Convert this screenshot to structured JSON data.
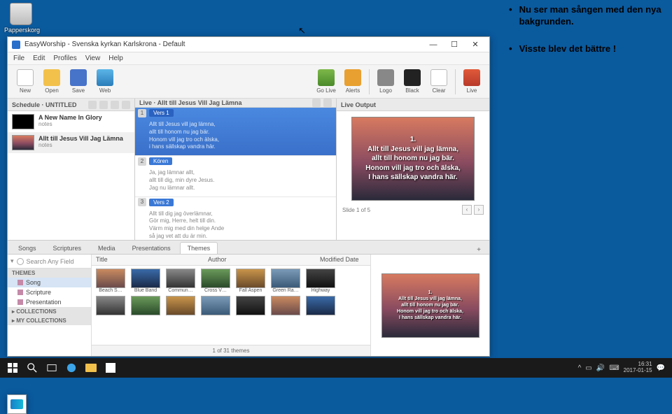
{
  "desktop": {
    "recycle_bin": "Papperskorg"
  },
  "annotations": [
    "Nu ser man sången med den nya bakgrunden.",
    "Visste blev det bättre !"
  ],
  "app": {
    "title": "EasyWorship - Svenska kyrkan Karlskrona - Default",
    "menu": [
      "File",
      "Edit",
      "Profiles",
      "View",
      "Help"
    ],
    "toolbar_left": [
      {
        "key": "new",
        "label": "New"
      },
      {
        "key": "open",
        "label": "Open"
      },
      {
        "key": "save",
        "label": "Save"
      },
      {
        "key": "web",
        "label": "Web"
      }
    ],
    "toolbar_right": [
      {
        "key": "golive",
        "label": "Go Live"
      },
      {
        "key": "alerts",
        "label": "Alerts"
      },
      {
        "sep": true
      },
      {
        "key": "logo",
        "label": "Logo"
      },
      {
        "key": "black",
        "label": "Black"
      },
      {
        "key": "clear",
        "label": "Clear"
      },
      {
        "sep": true
      },
      {
        "key": "live",
        "label": "Live"
      }
    ],
    "schedule": {
      "header": "Schedule · UNTITLED",
      "items": [
        {
          "title": "A New Name In Glory",
          "sub": "notes",
          "thumb": "black"
        },
        {
          "title": "Allt till Jesus Vill Jag Lämna",
          "sub": "notes",
          "thumb": "sun",
          "sel": true
        }
      ]
    },
    "live": {
      "header": "Live · Allt till Jesus Vill Jag Lämna",
      "verses": [
        {
          "num": "1",
          "label": "Vers 1",
          "sel": true,
          "lines": [
            "Allt till Jesus vill jag lämna,",
            "allt till honom nu jag bär.",
            "Honom vill jag tro och älska,",
            "i hans sällskap vandra här."
          ]
        },
        {
          "num": "2",
          "label": "Kören",
          "sel": false,
          "lines": [
            "Ja, jag lämnar allt,",
            "allt till dig, min dyre Jesus.",
            "Jag nu lämnar allt."
          ]
        },
        {
          "num": "3",
          "label": "Vers 2",
          "sel": false,
          "lines": [
            "Allt till dig jag överlämnar,",
            "Gör mig, Herre, helt till din.",
            "Värm mig med din helge Ande",
            "så jag vet att du är min."
          ]
        }
      ]
    },
    "output": {
      "header": "Live Output",
      "slide_text": "1.\nAllt till Jesus vill jag lämna,\nallt till honom nu jag bär.\nHonom vill jag tro och älska,\nI hans sällskap vandra här.",
      "nav": "Slide 1 of 5"
    },
    "bottom": {
      "tabs": [
        "Songs",
        "Scriptures",
        "Media",
        "Presentations",
        "Themes"
      ],
      "active_tab": 4,
      "plus": "+",
      "search_placeholder": "Search Any Field",
      "tree": {
        "header": "THEMES",
        "items": [
          "Song",
          "Scripture",
          "Presentation"
        ],
        "sections": [
          "COLLECTIONS",
          "MY COLLECTIONS"
        ]
      },
      "columns": [
        "Title",
        "Author",
        "Modified Date"
      ],
      "themes_row1": [
        "Beach S…",
        "Blue Band",
        "Commun…",
        "Cross V…",
        "Fall Aspen",
        "Green Ra…",
        "Highway"
      ],
      "status": "1 of 31 themes",
      "preview_text": "1.\nAllt till Jesus vill jag lämna,\nallt till honom nu jag bär.\nHonom vill jag tro och älska,\nI hans sällskap vandra här."
    }
  },
  "taskbar": {
    "clock_time": "16:31",
    "clock_date": "2017-01-15"
  }
}
